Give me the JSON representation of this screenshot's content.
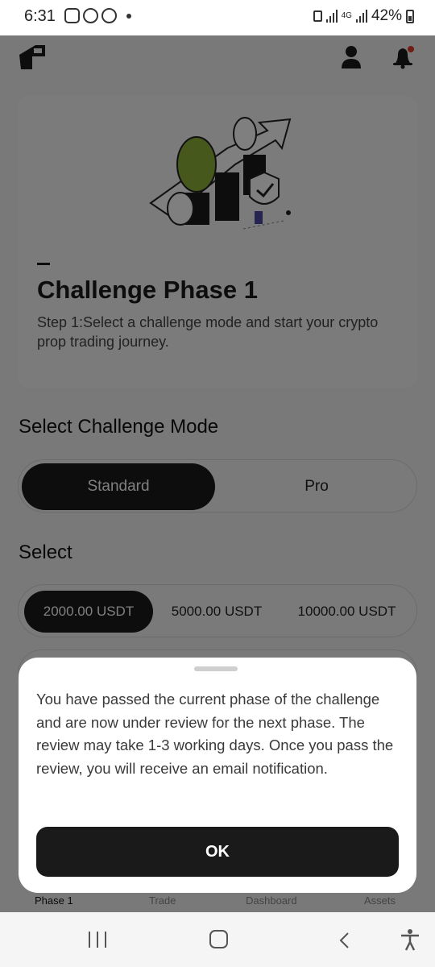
{
  "status_bar": {
    "time": "6:31",
    "network": "4G",
    "battery": "42%"
  },
  "app": {
    "hero": {
      "title": "Challenge Phase 1",
      "subtitle": "Step 1:Select a challenge mode and start your crypto prop trading journey."
    },
    "challenge_mode": {
      "heading": "Select Challenge Mode",
      "options": [
        "Standard",
        "Pro"
      ],
      "selected": "Standard"
    },
    "amount": {
      "heading": "Select",
      "options": [
        "2000.00 USDT",
        "5000.00 USDT",
        "10000.00 USDT"
      ],
      "selected": "2000.00 USDT"
    },
    "tabs": [
      "Phase 1",
      "Trade",
      "Dashboard",
      "Assets"
    ]
  },
  "modal": {
    "message": "You have passed the current phase of the challenge and are now under review for the next phase. The review may take 1-3 working days. Once you pass the review, you will receive an email notification.",
    "ok_label": "OK"
  },
  "colors": {
    "primary": "#1a1a1a",
    "accent_green": "#8fb03a",
    "notification_dot": "#e03a2a",
    "overlay": "rgba(0,0,0,0.5)"
  },
  "icons": [
    "instagram-icon",
    "whatsapp-icon",
    "messenger-icon",
    "signal-icon",
    "battery-icon",
    "logo-icon",
    "user-icon",
    "bell-icon",
    "recent-apps-icon",
    "home-icon",
    "back-icon",
    "accessibility-icon"
  ]
}
